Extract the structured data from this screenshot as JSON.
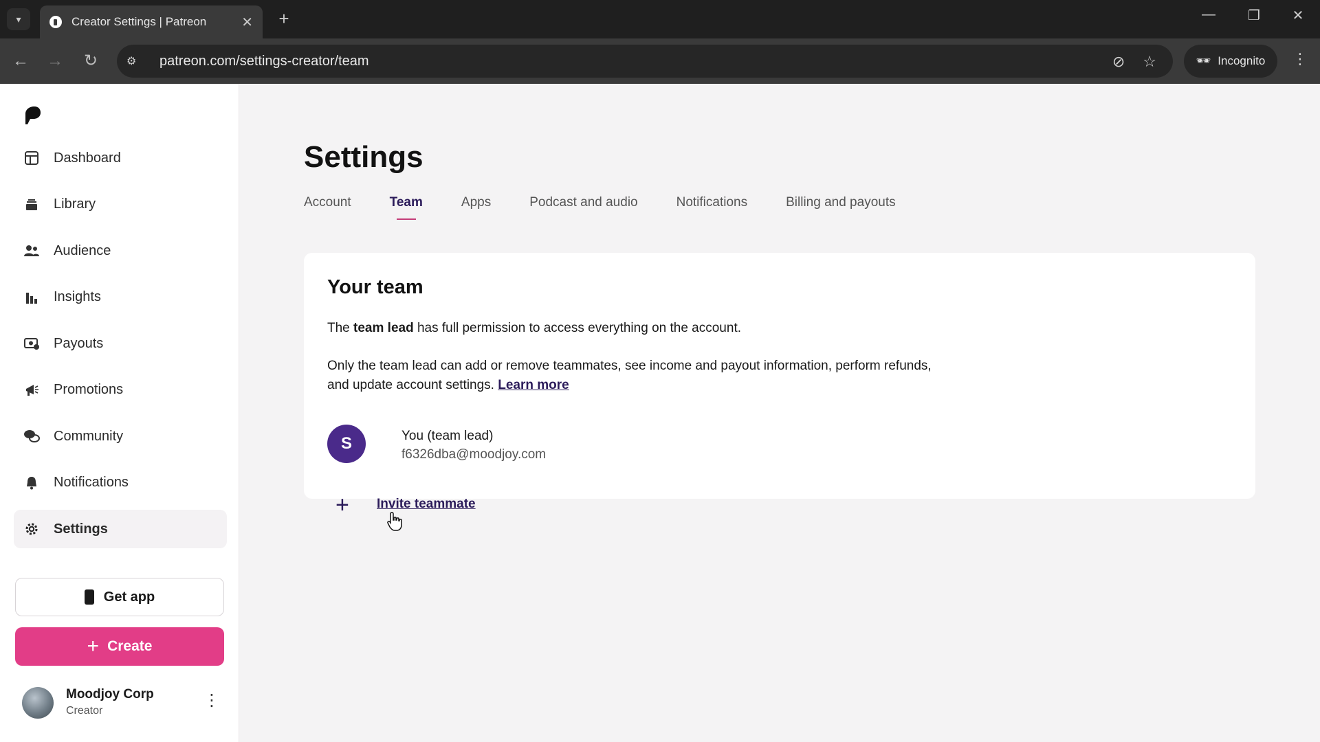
{
  "browser": {
    "tab_title": "Creator Settings | Patreon",
    "url": "patreon.com/settings-creator/team",
    "incognito_label": "Incognito"
  },
  "sidebar": {
    "items": [
      {
        "label": "Dashboard",
        "icon": "dashboard-icon"
      },
      {
        "label": "Library",
        "icon": "library-icon"
      },
      {
        "label": "Audience",
        "icon": "audience-icon"
      },
      {
        "label": "Insights",
        "icon": "insights-icon"
      },
      {
        "label": "Payouts",
        "icon": "payouts-icon"
      },
      {
        "label": "Promotions",
        "icon": "promotions-icon"
      },
      {
        "label": "Community",
        "icon": "community-icon"
      },
      {
        "label": "Notifications",
        "icon": "bell-icon"
      },
      {
        "label": "Settings",
        "icon": "gear-icon",
        "active": true
      }
    ],
    "get_app_label": "Get app",
    "create_label": "Create",
    "profile": {
      "name": "Moodjoy Corp",
      "role": "Creator"
    }
  },
  "page": {
    "title": "Settings",
    "tabs": [
      {
        "label": "Account"
      },
      {
        "label": "Team",
        "active": true
      },
      {
        "label": "Apps"
      },
      {
        "label": "Podcast and audio"
      },
      {
        "label": "Notifications"
      },
      {
        "label": "Billing and payouts"
      }
    ]
  },
  "team_card": {
    "title": "Your team",
    "para1_prefix": "The ",
    "para1_bold": "team lead",
    "para1_suffix": " has full permission to access everything on the account.",
    "para2_text": "Only the team lead can add or remove teammates, see income and payout information, perform refunds, and update account settings. ",
    "learn_more": "Learn more",
    "member": {
      "initial": "S",
      "name": "You  (team lead)",
      "email": "f6326dba@moodjoy.com"
    },
    "invite_label": "Invite teammate"
  },
  "colors": {
    "accent": "#e23d87",
    "brand_purple": "#2b1b5a",
    "avatar_purple": "#4a2a8a"
  }
}
